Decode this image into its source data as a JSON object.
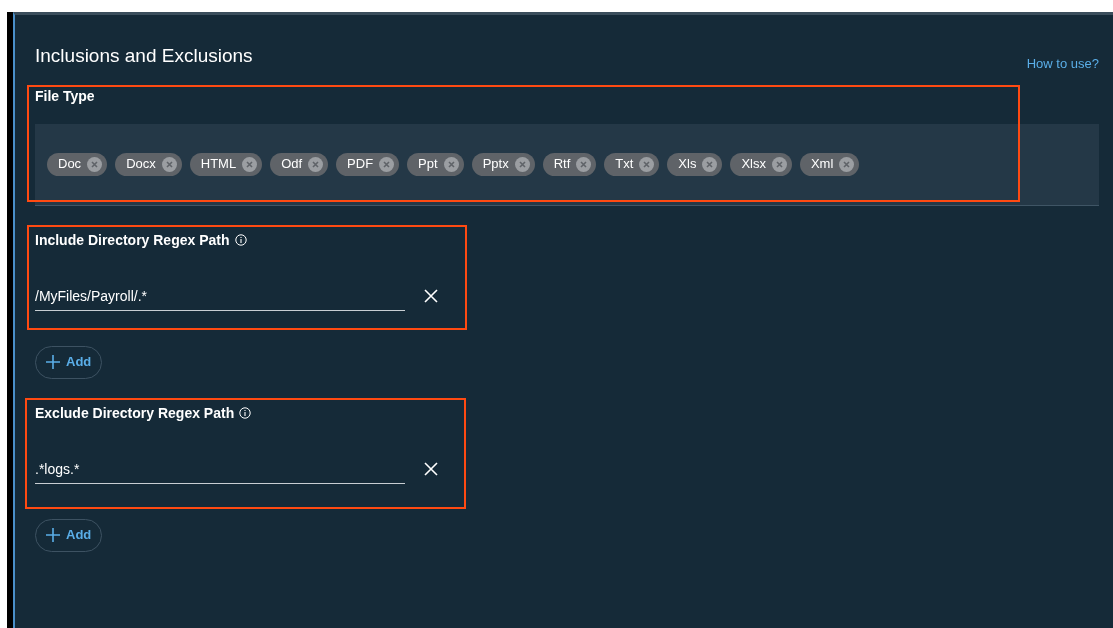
{
  "title": "Inclusions and Exclusions",
  "help_link": "How to use?",
  "file_type": {
    "label": "File Type",
    "chips": [
      "Doc",
      "Docx",
      "HTML",
      "Odf",
      "PDF",
      "Ppt",
      "Pptx",
      "Rtf",
      "Txt",
      "Xls",
      "Xlsx",
      "Xml"
    ]
  },
  "path_sections": [
    {
      "label": "Include Directory Regex Path",
      "value": "/MyFiles/Payroll/.*",
      "add_button": "Add"
    },
    {
      "label": "Exclude Directory Regex Path",
      "value": ".*logs.*",
      "add_button": "Add"
    }
  ]
}
